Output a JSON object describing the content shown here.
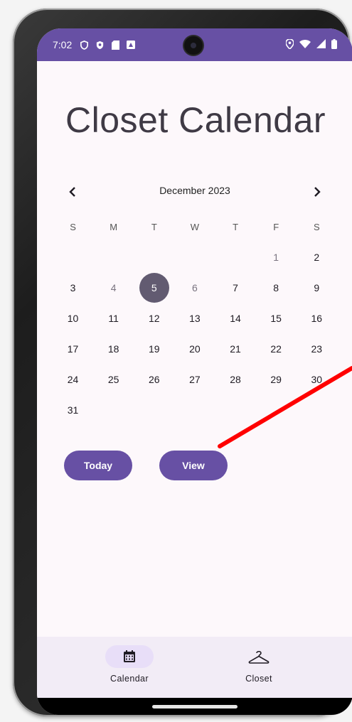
{
  "status_bar": {
    "time": "7:02",
    "left_icons": [
      "vpn-key-icon",
      "shield-icon",
      "sd-card-icon",
      "notification-icon"
    ],
    "right_icons": [
      "location-icon",
      "wifi-icon",
      "signal-icon",
      "battery-icon"
    ]
  },
  "page": {
    "title": "Closet Calendar"
  },
  "calendar": {
    "month_label": "December 2023",
    "weekday_headers": [
      "S",
      "M",
      "T",
      "W",
      "T",
      "F",
      "S"
    ],
    "selected_day": "5",
    "weeks": [
      [
        "",
        "",
        "",
        "",
        "",
        "1",
        "2"
      ],
      [
        "3",
        "4",
        "5",
        "6",
        "7",
        "8",
        "9"
      ],
      [
        "10",
        "11",
        "12",
        "13",
        "14",
        "15",
        "16"
      ],
      [
        "17",
        "18",
        "19",
        "20",
        "21",
        "22",
        "23"
      ],
      [
        "24",
        "25",
        "26",
        "27",
        "28",
        "29",
        "30"
      ],
      [
        "31",
        "",
        "",
        "",
        "",
        "",
        ""
      ]
    ]
  },
  "actions": {
    "today_label": "Today",
    "view_label": "View"
  },
  "bottom_nav": {
    "items": [
      {
        "label": "Calendar",
        "icon": "calendar-icon",
        "active": true
      },
      {
        "label": "Closet",
        "icon": "hanger-icon",
        "active": false
      }
    ]
  },
  "colors": {
    "primary": "#6750a4",
    "selected_day": "#625b71",
    "nav_background": "#f2ecf6",
    "nav_active_pill": "#e8def8",
    "annotation": "#ff0000"
  }
}
